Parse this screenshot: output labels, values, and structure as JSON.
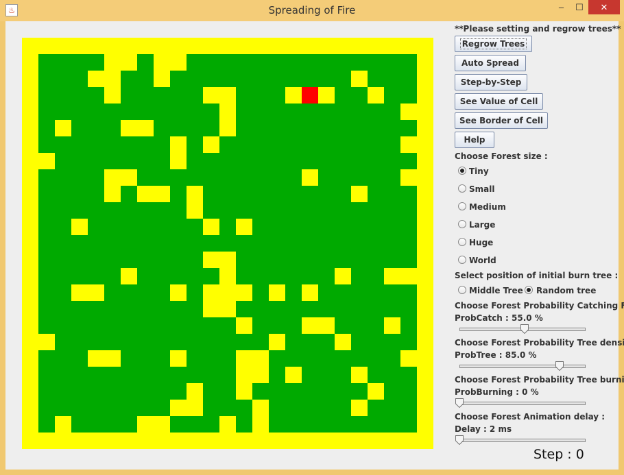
{
  "window": {
    "title": "Spreading of Fire",
    "minimize_glyph": "–",
    "maximize_glyph": "☐",
    "close_glyph": "✕",
    "app_icon": "java-cup-icon"
  },
  "colors": {
    "tree": "#00aa00",
    "empty": "#ffff00",
    "burning": "#ff0000",
    "titlebar": "#f4cc78",
    "close": "#c7372f"
  },
  "forest": {
    "rows": 25,
    "cols": 25,
    "grid": [
      "EEEEEEEEEEEEEEEEEEEEEEEEE",
      "ETTTTEETEETTTTTTTTTTTTTTE",
      "ETTTEETTETTTTTTTTTTTETTTE",
      "ETTTTETTTTTEETTTEBETTETTE",
      "ETTTTTTTTTTTETTTTTTTTTTEE",
      "ETETTTEETTTTETTTTTTTTTTTE",
      "ETTTTTTTTETETTTTTTTTTTTEE",
      "EETTTTTTTETTTTTTTTTTTTTTE",
      "ETTTTEETTTTTTTTTTETTTTTEE",
      "ETTTTETEETETTTTTTTTTETTTE",
      "ETTTTTTTTTETTTTTTTTTTTTTE",
      "ETTETTTTTTTETETTTTTTTTTTE",
      "ETTTTTTTTTTTTTTTTTTTTTTTE",
      "ETTTTTTTTTTEETTTTTTTTTTTE",
      "ETTTTTETTTTTETTTTTTETTEEE",
      "ETTEETTTTETEEETETETTTTTTE",
      "ETTTTTTTTTTEETTTTTTTTTTTE",
      "ETTTTTTTTTTTTETTTEETTTETE",
      "EETTTTTTTTTTTTTETTTETTTTE",
      "ETTTEETTTETTTEETTTTTTTTEE",
      "ETTTTTTTTTTTTEETETTTETTTE",
      "ETTTTTTTTTETTETTTTTTTETTE",
      "ETTTTTTTTEETTTETTTTTETTTE",
      "ETETTTTEETTTETETTTTTTTTTE",
      "EEEEEEEEEEEEEEEEEEEEEEEEE"
    ]
  },
  "panel": {
    "notice": "**Please setting and regrow trees**",
    "buttons": {
      "regrow": "Regrow Trees",
      "auto_spread": "Auto Spread",
      "step_by_step": "Step-by-Step",
      "see_value": "See Value of Cell",
      "see_border": "See Border of Cell",
      "help": "Help"
    },
    "forest_size_label": "Choose Forest size :",
    "sizes": [
      "Tiny",
      "Small",
      "Medium",
      "Large",
      "Huge",
      "World"
    ],
    "selected_size": "Tiny",
    "position_label": "Select position of initial burn tree :",
    "positions": [
      "Middle Tree",
      "Random tree"
    ],
    "selected_position": "Random tree",
    "catch": {
      "label": "Choose Forest Probability Catching Fire :",
      "value_text": "ProbCatch : 55.0 %",
      "value": 0.55
    },
    "density": {
      "label": "Choose Forest Probability Tree density :",
      "value_text": "ProbTree : 85.0 %",
      "value": 0.85
    },
    "burning": {
      "label": "Choose Forest Probability Tree burning :",
      "value_text": "ProbBurning : 0 %",
      "value": 0.0
    },
    "delay": {
      "label": "Choose Forest Animation delay :",
      "value_text": "Delay : 2 ms",
      "value": 0.0
    },
    "step_text": "Step : 0"
  }
}
